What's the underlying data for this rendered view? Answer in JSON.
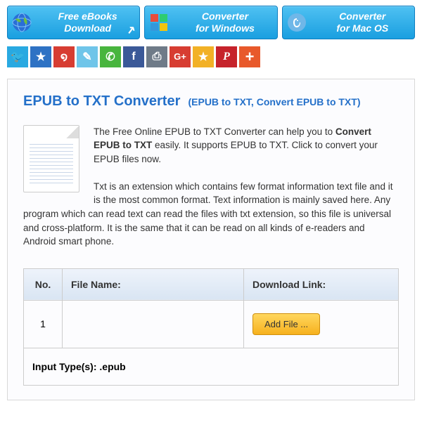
{
  "nav": [
    {
      "line1": "Free eBooks",
      "line2": "Download",
      "icon": "globe"
    },
    {
      "line1": "Converter",
      "line2": "for Windows",
      "icon": "windows"
    },
    {
      "line1": "Converter",
      "line2": "for Mac OS",
      "icon": "mac"
    }
  ],
  "social": [
    {
      "name": "twitter",
      "bg": "#29a9e1",
      "glyph": "🐦"
    },
    {
      "name": "qzone",
      "bg": "#2e72c4",
      "glyph": "★"
    },
    {
      "name": "weibo",
      "bg": "#d73d32",
      "glyph": "໑"
    },
    {
      "name": "tencent",
      "bg": "#6fc5e9",
      "glyph": "✎"
    },
    {
      "name": "wechat",
      "bg": "#48b53e",
      "glyph": "✆"
    },
    {
      "name": "facebook",
      "bg": "#3b5998",
      "glyph": "f"
    },
    {
      "name": "print",
      "bg": "#6f7b88",
      "glyph": "⎙"
    },
    {
      "name": "gplus",
      "bg": "#d73d32",
      "glyph": "G+"
    },
    {
      "name": "favorite",
      "bg": "#f2b126",
      "glyph": "★"
    },
    {
      "name": "pinterest",
      "bg": "#c6232b",
      "glyph": "P"
    },
    {
      "name": "more",
      "bg": "#e8592b",
      "glyph": "+"
    }
  ],
  "page": {
    "title": "EPUB to TXT Converter",
    "subtitle": "(EPUB to TXT, Convert EPUB to TXT)",
    "desc_p1_a": "The Free Online EPUB to TXT Converter can help you to ",
    "desc_p1_bold": "Convert EPUB to TXT",
    "desc_p1_b": " easily. It supports EPUB to TXT. Click to convert your EPUB files now.",
    "desc_p2": "Txt is an extension which contains few format information text file and it is the most common format. Text information is mainly saved here. Any program which can read text can read the files with txt extension, so this file is universal and cross-platform. It is the same that it can be read on all kinds of e-readers and Android smart phone."
  },
  "table": {
    "h_no": "No.",
    "h_file": "File Name:",
    "h_link": "Download Link:",
    "row_no": "1",
    "add_file": "Add File ...",
    "input_types_label": "Input Type(s): ",
    "input_types_value": ".epub"
  }
}
